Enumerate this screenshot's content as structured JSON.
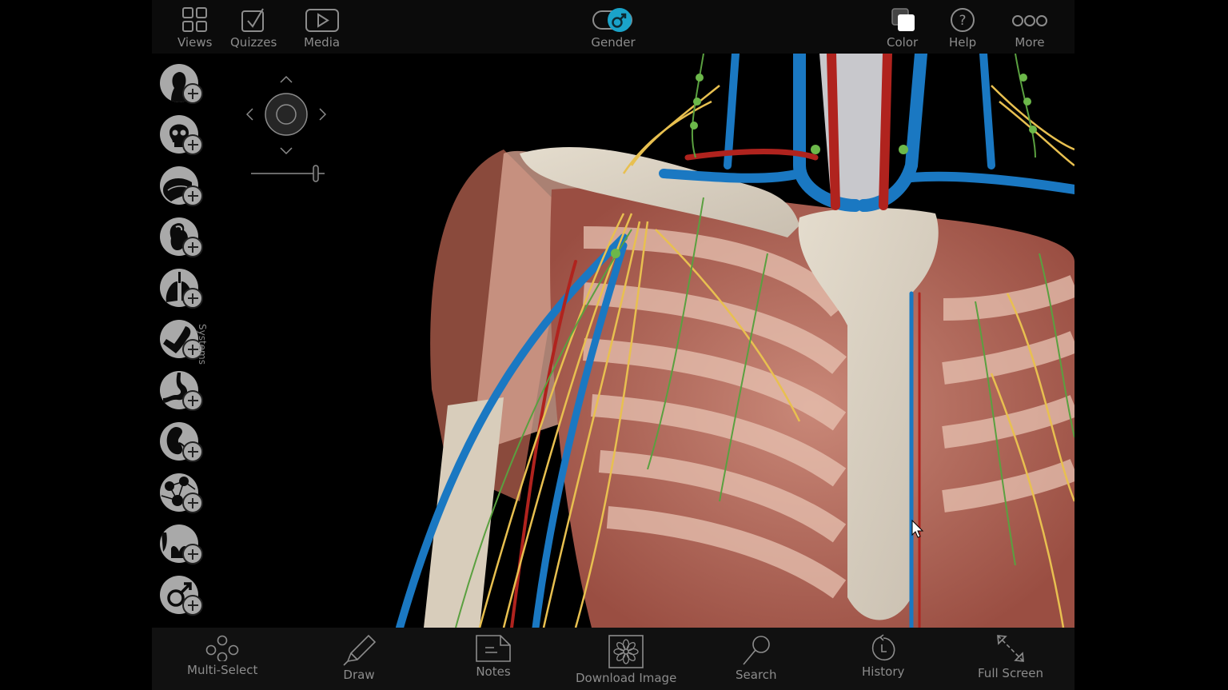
{
  "top_toolbar": {
    "left": [
      {
        "id": "views",
        "label": "Views",
        "icon": "grid-icon"
      },
      {
        "id": "quizzes",
        "label": "Quizzes",
        "icon": "checkbox-icon"
      },
      {
        "id": "media",
        "label": "Media",
        "icon": "play-icon"
      }
    ],
    "center": {
      "id": "gender",
      "label": "Gender",
      "icon": "male-symbol-icon",
      "toggle_state": "male",
      "accent": "#1aa3c9"
    },
    "right": [
      {
        "id": "color",
        "label": "Color",
        "icon": "color-squares-icon"
      },
      {
        "id": "help",
        "label": "Help",
        "icon": "question-icon"
      },
      {
        "id": "more",
        "label": "More",
        "icon": "three-circles-icon"
      }
    ]
  },
  "systems_panel": {
    "label": "Systems",
    "items": [
      {
        "name": "skin",
        "icon": "head-silhouette-icon"
      },
      {
        "name": "skeletal",
        "icon": "skull-icon"
      },
      {
        "name": "nervous",
        "icon": "brain-icon"
      },
      {
        "name": "cardiovascular",
        "icon": "heart-icon"
      },
      {
        "name": "respiratory",
        "icon": "lungs-icon"
      },
      {
        "name": "muscular",
        "icon": "arm-muscle-icon"
      },
      {
        "name": "digestive",
        "icon": "stomach-icon"
      },
      {
        "name": "urinary",
        "icon": "kidney-icon"
      },
      {
        "name": "lymphatic",
        "icon": "lymph-nodes-icon"
      },
      {
        "name": "endocrine",
        "icon": "thyroid-icon"
      },
      {
        "name": "reproductive",
        "icon": "male-symbol-icon"
      }
    ]
  },
  "navigation_control": {
    "zoom_slider_value": 0.88
  },
  "bottom_toolbar": [
    {
      "id": "multi-select",
      "label": "Multi-Select",
      "icon": "multi-circles-icon"
    },
    {
      "id": "draw",
      "label": "Draw",
      "icon": "pencil-icon"
    },
    {
      "id": "notes",
      "label": "Notes",
      "icon": "note-icon"
    },
    {
      "id": "download-image",
      "label": "Download Image",
      "icon": "flower-image-icon"
    },
    {
      "id": "search",
      "label": "Search",
      "icon": "magnifier-icon"
    },
    {
      "id": "history",
      "label": "History",
      "icon": "clock-icon"
    },
    {
      "id": "full-screen",
      "label": "Full Screen",
      "icon": "diagonal-arrows-icon"
    }
  ],
  "viewport": {
    "subject": "3D anatomy model: shoulder and thoracic region with ribs, sternum, clavicle, veins, arteries, nerves and lymphatics",
    "colors": {
      "vein": "#1a78c2",
      "artery": "#b0231e",
      "nerve": "#e8c050",
      "lymph": "#5aa040",
      "bone": "#d9cfc0",
      "muscle": "#a0584a"
    }
  }
}
